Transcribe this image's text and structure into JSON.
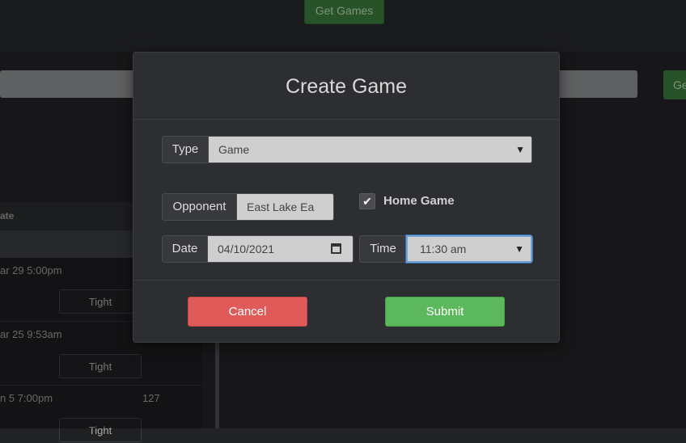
{
  "background": {
    "get_games_label": "Get Games",
    "right_button_label": "Get",
    "table_header": "ate",
    "rows": [
      {
        "date": "ar 29 5:00pm",
        "tag": "Tight"
      },
      {
        "date": "ar 25 9:53am",
        "tag": "Tight"
      },
      {
        "date": "n 5 7:00pm",
        "count": "127",
        "tag": "Tight"
      }
    ]
  },
  "modal": {
    "title": "Create Game",
    "type": {
      "label": "Type",
      "selected": "Game"
    },
    "opponent": {
      "label": "Opponent",
      "value": "East Lake Ea"
    },
    "home_game": {
      "label": "Home Game",
      "checked": true,
      "check_glyph": "✔"
    },
    "date": {
      "label": "Date",
      "value": "04/10/2021"
    },
    "time": {
      "label": "Time",
      "selected": "11:30 am"
    },
    "cancel_label": "Cancel",
    "submit_label": "Submit"
  },
  "icons": {
    "select_arrow": "chevron-down-icon",
    "calendar": "calendar-icon",
    "check": "checkmark-icon"
  }
}
